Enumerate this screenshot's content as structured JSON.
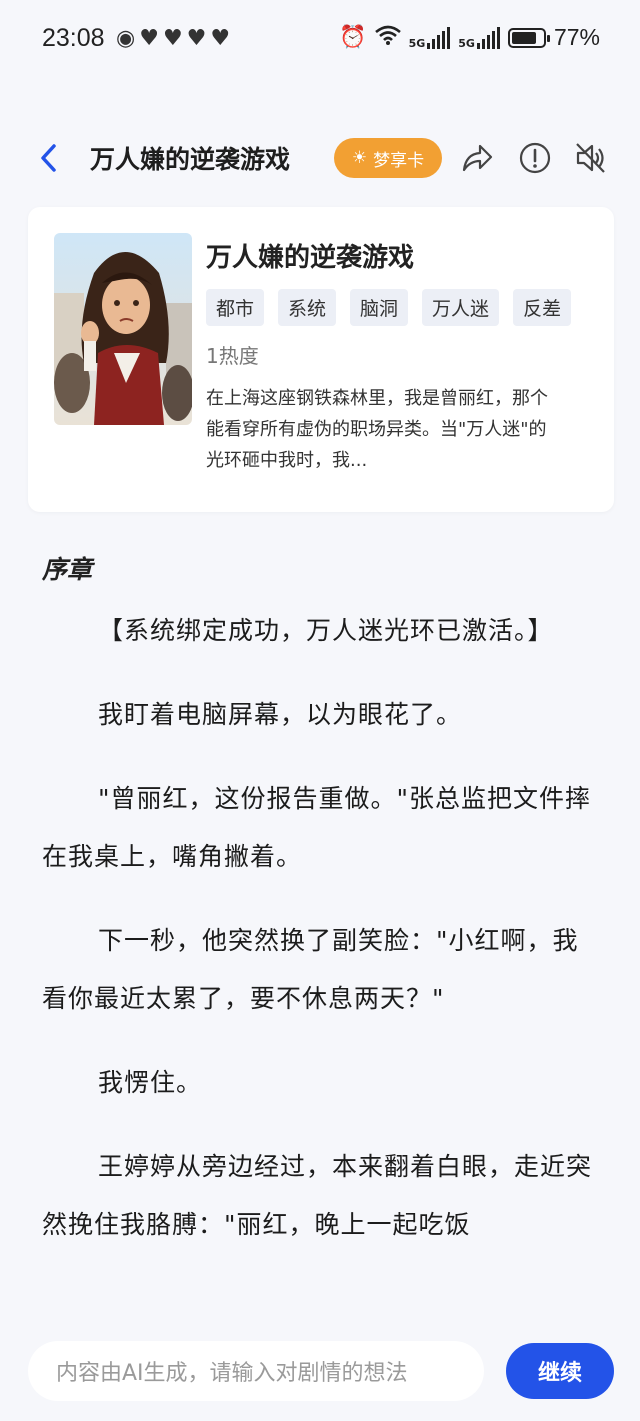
{
  "status_bar": {
    "time": "23:08",
    "battery": "77%",
    "net1": "5G",
    "net2": "5G"
  },
  "header": {
    "title": "万人嫌的逆袭游戏",
    "vip_label": "梦享卡"
  },
  "book": {
    "title": "万人嫌的逆袭游戏",
    "tags": [
      "都市",
      "系统",
      "脑洞",
      "万人迷",
      "反差"
    ],
    "heat": "1热度",
    "description": "在上海这座钢铁森林里，我是曾丽红，那个能看穿所有虚伪的职场异类。当\"万人迷\"的光环砸中我时，我..."
  },
  "chapter": {
    "title": "序章",
    "paragraphs": [
      "【系统绑定成功，万人迷光环已激活。】",
      "我盯着电脑屏幕，以为眼花了。",
      "\"曾丽红，这份报告重做。\"张总监把文件摔在我桌上，嘴角撇着。",
      "下一秒，他突然换了副笑脸：\"小红啊，我看你最近太累了，要不休息两天？\"",
      "我愣住。",
      "王婷婷从旁边经过，本来翻着白眼，走近突然挽住我胳膊：\"丽红，晚上一起吃饭"
    ]
  },
  "input": {
    "placeholder": "内容由AI生成，请输入对剧情的想法",
    "continue_label": "继续"
  }
}
